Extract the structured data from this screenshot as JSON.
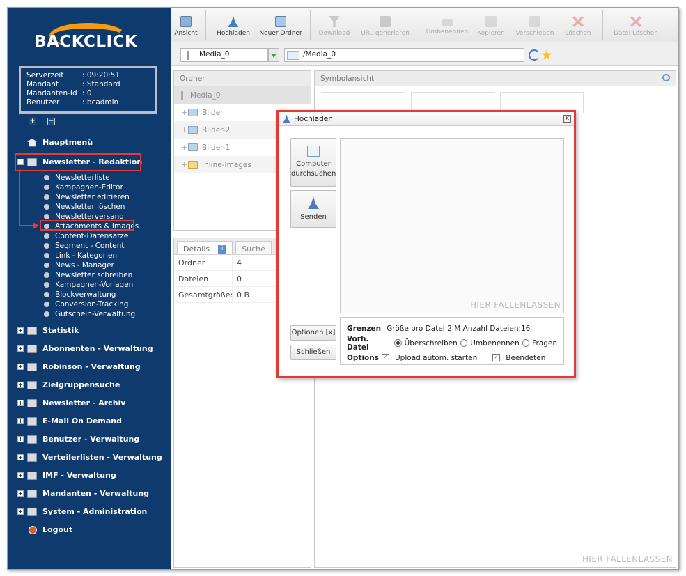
{
  "logo": {
    "text": "BACKCLICK"
  },
  "info": {
    "rows": [
      {
        "k": "Serverzeit",
        "v": ": 09:20:51"
      },
      {
        "k": "Mandant",
        "v": ": Standard"
      },
      {
        "k": "Mandanten-Id",
        "v": ": 0"
      },
      {
        "k": "Benutzer",
        "v": ": bcadmin"
      }
    ]
  },
  "sidebar": {
    "expand_all": "+",
    "collapse_all": "−",
    "hauptmenue": "Hauptmenü",
    "newsletter_redaktion": "Newsletter - Redaktion",
    "sub": [
      "Newsletterliste",
      "Kampagnen-Editor",
      "Newsletter editieren",
      "Newsletter löschen",
      "Newsletterversand",
      "Attachments & Images",
      "Content-Datensätze",
      "Segment - Content",
      "Link - Kategorien",
      "News - Manager",
      "Newsletter schreiben",
      "Kampagnen-Vorlagen",
      "Blockverwaltung",
      "Conversion-Tracking",
      "Gutschein-Verwaltung"
    ],
    "menus": [
      "Statistik",
      "Abonnenten - Verwaltung",
      "Robinson - Verwaltung",
      "Zielgruppensuche",
      "Newsletter - Archiv",
      "E-Mail On Demand",
      "Benutzer - Verwaltung",
      "Verteilerlisten - Verwaltung",
      "IMF - Verwaltung",
      "Mandanten - Verwaltung",
      "System - Administration"
    ],
    "logout": "Logout"
  },
  "toolbar": {
    "ansicht": "Ansicht",
    "hochladen": "Hochladen",
    "neuer_ordner": "Neuer Ordner",
    "download": "Download",
    "url_generieren": "URL generieren",
    "umbenennen": "Umbenennen",
    "kopieren": "Kopieren",
    "verschieben": "Verschieben",
    "loeschen": "Löschen",
    "datei_loeschen": "Datei Löschen"
  },
  "pathbar": {
    "dropdown": "Media_0",
    "path": "/Media_0"
  },
  "folders": {
    "title": "Ordner",
    "root": "Media_0",
    "items": [
      "Bilder",
      "Bilder-2",
      "Bilder-1",
      "Inline-Images"
    ]
  },
  "details": {
    "tab_details": "Details",
    "tab_suche": "Suche",
    "rows": [
      {
        "k": "Ordner",
        "v": "4"
      },
      {
        "k": "Dateien",
        "v": "0"
      },
      {
        "k": "Gesamtgröße:",
        "v": "0 B"
      }
    ]
  },
  "symbol": {
    "title": "Symbolansicht",
    "drop": "HIER FALLENLASSEN"
  },
  "dialog": {
    "title": "Hochladen",
    "close": "x",
    "browse": "Computer durchsuchen",
    "send": "Senden",
    "optionen": "Optionen [x]",
    "schliessen": "Schließen",
    "drop": "HIER FALLENLASSEN",
    "grenzen_label": "Grenzen",
    "grenzen_value": "Größe pro Datei:2 M  Anzahl Dateien:16",
    "vorh_label": "Vorh. Datei",
    "opt_ueberschreiben": "Überschreiben",
    "opt_umbenennen": "Umbenennen",
    "opt_fragen": "Fragen",
    "options_label": "Options",
    "upload_autom": "Upload autom. starten",
    "beenden": "Beendeten"
  }
}
